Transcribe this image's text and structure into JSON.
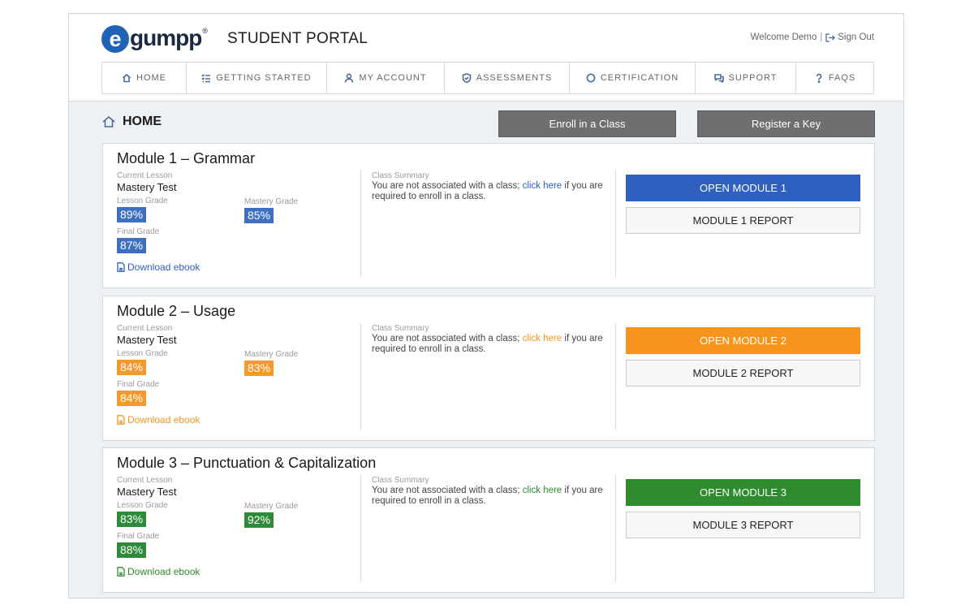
{
  "header": {
    "logo_e": "e",
    "logo_text": "gumpp",
    "logo_reg": "®",
    "portal_title": "STUDENT PORTAL",
    "welcome": "Welcome Demo",
    "separator": "|",
    "sign_out": "Sign Out"
  },
  "nav": [
    {
      "label": "HOME",
      "icon": "home-icon"
    },
    {
      "label": "GETTING STARTED",
      "icon": "checklist-icon"
    },
    {
      "label": "MY ACCOUNT",
      "icon": "user-icon"
    },
    {
      "label": "ASSESSMENTS",
      "icon": "shield-icon"
    },
    {
      "label": "CERTIFICATION",
      "icon": "circle-icon"
    },
    {
      "label": "SUPPORT",
      "icon": "chat-icon"
    },
    {
      "label": "FAQS",
      "icon": "question-icon"
    }
  ],
  "page": {
    "title": "HOME",
    "enroll_label": "Enroll in a Class",
    "register_label": "Register a Key"
  },
  "labels": {
    "current_lesson": "Current Lesson",
    "lesson_grade": "Lesson Grade",
    "mastery_grade": "Mastery Grade",
    "final_grade": "Final Grade",
    "download": "Download ebook",
    "class_summary": "Class Summary",
    "summary_pre": "You are not associated with a class;",
    "summary_link": "click here",
    "summary_post": "if you are required to enroll in a class."
  },
  "modules": [
    {
      "title": "Module 1 – Grammar",
      "current_lesson": "Mastery Test",
      "lesson_grade": "89%",
      "mastery_grade": "85%",
      "final_grade": "87%",
      "open_label": "OPEN MODULE 1",
      "report_label": "MODULE 1 REPORT",
      "color": "#2f5fbf",
      "badge_color": "#3f6fc0"
    },
    {
      "title": "Module 2 – Usage",
      "current_lesson": "Mastery Test",
      "lesson_grade": "84%",
      "mastery_grade": "83%",
      "final_grade": "84%",
      "open_label": "OPEN MODULE 2",
      "report_label": "MODULE 2 REPORT",
      "color": "#f7941d",
      "badge_color": "#f39a2a"
    },
    {
      "title": "Module 3 – Punctuation & Capitalization",
      "current_lesson": "Mastery Test",
      "lesson_grade": "83%",
      "mastery_grade": "92%",
      "final_grade": "88%",
      "open_label": "OPEN MODULE 3",
      "report_label": "MODULE 3 REPORT",
      "color": "#2e8b2e",
      "badge_color": "#2e8b3a"
    }
  ]
}
